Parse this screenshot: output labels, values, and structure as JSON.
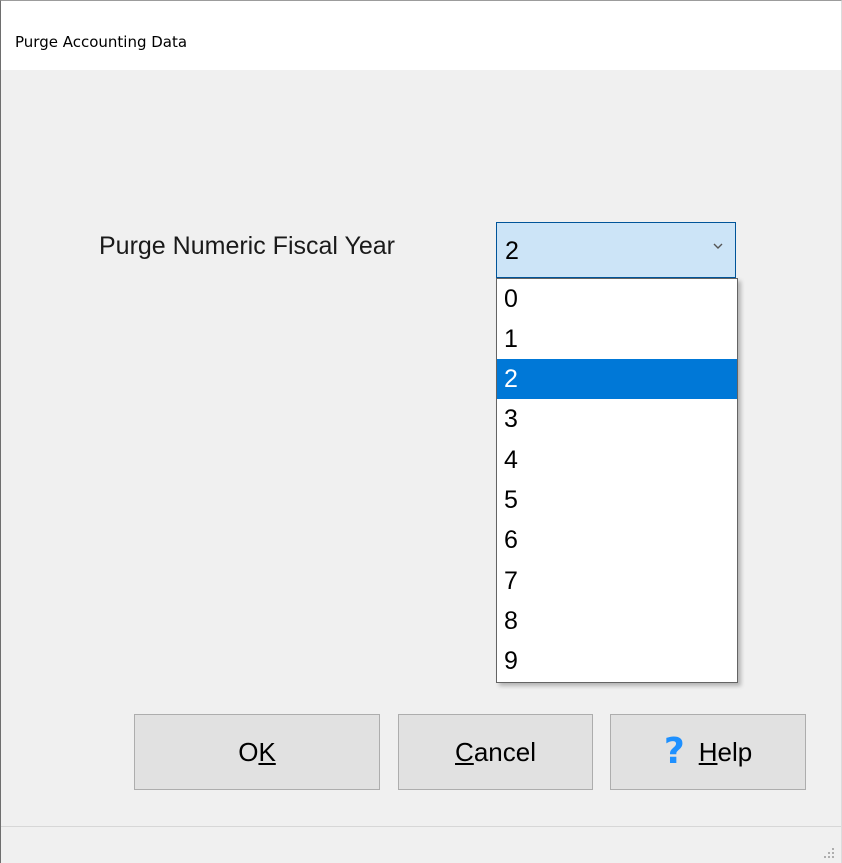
{
  "window": {
    "title": "Purge Accounting Data"
  },
  "form": {
    "field_label": "Purge Numeric Fiscal Year",
    "selected_value": "2",
    "options": [
      "0",
      "1",
      "2",
      "3",
      "4",
      "5",
      "6",
      "7",
      "8",
      "9"
    ],
    "selected_index": 2
  },
  "buttons": {
    "ok": {
      "pre": "O",
      "mnemonic": "K",
      "post": ""
    },
    "cancel": {
      "pre": "",
      "mnemonic": "C",
      "post": "ancel"
    },
    "help": {
      "icon": "?",
      "pre": "",
      "mnemonic": "H",
      "post": "elp"
    }
  },
  "icons": {
    "dropdown_arrow": "chevron-down-icon",
    "help": "question-mark-icon",
    "resize": "resize-grip-icon"
  },
  "colors": {
    "selection": "#0078d7",
    "combo_focus": "#cce4f7",
    "help_icon": "#1e90ff"
  }
}
